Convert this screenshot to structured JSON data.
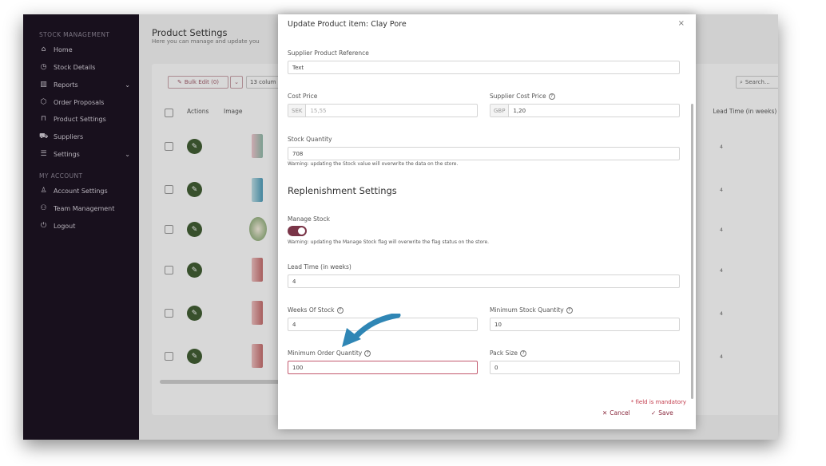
{
  "sidebar": {
    "section_stock": "STOCK MANAGEMENT",
    "items": [
      {
        "label": "Home",
        "icon": "home-icon",
        "glyph": "⌂"
      },
      {
        "label": "Stock Details",
        "icon": "clock-icon",
        "glyph": "◷"
      },
      {
        "label": "Reports",
        "icon": "bar-chart-icon",
        "glyph": "▥"
      },
      {
        "label": "Order Proposals",
        "icon": "box-icon",
        "glyph": "⬡"
      },
      {
        "label": "Product Settings",
        "icon": "bag-icon",
        "glyph": "⊓"
      },
      {
        "label": "Suppliers",
        "icon": "truck-icon",
        "glyph": "⛟"
      },
      {
        "label": "Settings",
        "icon": "sliders-icon",
        "glyph": "☰"
      }
    ],
    "section_account": "MY ACCOUNT",
    "account_items": [
      {
        "label": "Account Settings",
        "icon": "user-icon",
        "glyph": "♙"
      },
      {
        "label": "Team Management",
        "icon": "team-icon",
        "glyph": "⚇"
      },
      {
        "label": "Logout",
        "icon": "power-icon",
        "glyph": "⏻"
      }
    ]
  },
  "page": {
    "title": "Product Settings",
    "subtitle": "Here you can manage and update you",
    "bulk_edit": "Bulk Edit (0)",
    "columns": "13 colum",
    "search_placeholder": "Search...",
    "col_actions": "Actions",
    "col_image": "Image",
    "col_lead_time": "Lead Time (in weeks)",
    "lead_values": [
      "4",
      "4",
      "4",
      "4",
      "4",
      "4"
    ]
  },
  "modal": {
    "title": "Update Product item: Clay Pore",
    "supplier_ref_label": "Supplier Product Reference",
    "supplier_ref_value": "Text",
    "cost_price_label": "Cost Price",
    "cost_price_currency": "SEK",
    "cost_price_value": "15,55",
    "supplier_cost_label": "Supplier Cost Price",
    "supplier_cost_currency": "GBP",
    "supplier_cost_value": "1,20",
    "stock_qty_label": "Stock Quantity",
    "stock_qty_value": "708",
    "stock_warning": "Warning: updating the Stock value will overwrite the data on the store.",
    "replenishment_heading": "Replenishment Settings",
    "manage_stock_label": "Manage Stock",
    "manage_stock_on": true,
    "manage_stock_warning": "Warning: updating the Manage Stock flag will overwrite the flag status on the store.",
    "lead_time_label": "Lead Time (in weeks)",
    "lead_time_value": "4",
    "weeks_of_stock_label": "Weeks Of Stock",
    "weeks_of_stock_value": "4",
    "min_stock_label": "Minimum Stock Quantity",
    "min_stock_value": "10",
    "min_order_label": "Minimum Order Quantity",
    "min_order_value": "100",
    "pack_size_label": "Pack Size",
    "pack_size_value": "0",
    "mandatory_note": "* field is mandatory",
    "cancel_label": "Cancel",
    "save_label": "Save"
  },
  "colors": {
    "sidebar_bg": "#150b1c",
    "accent": "#7a3548",
    "edit_button": "#3c5a2e",
    "annotation_arrow": "#2f86b5"
  }
}
